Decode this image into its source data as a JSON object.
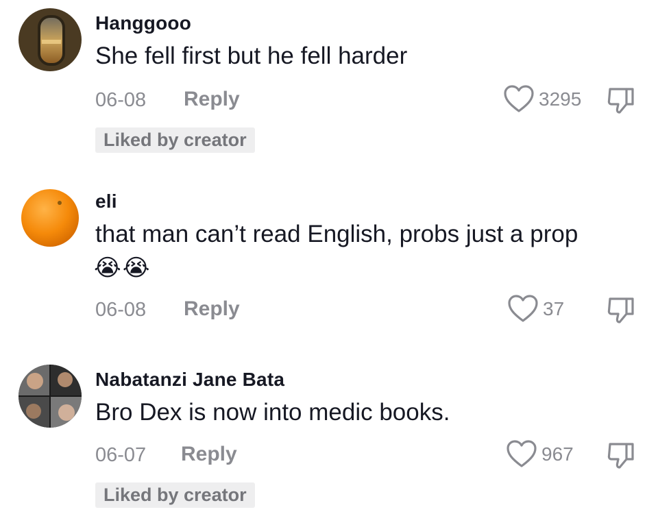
{
  "comments": [
    {
      "username": "Hanggooo",
      "text": "She fell first but he fell harder",
      "date": "06-08",
      "reply_label": "Reply",
      "likes": "3295",
      "badge": "Liked by creator",
      "avatar_icon": "airplane-window-sunset-avatar"
    },
    {
      "username": "eli",
      "text": "that man can’t read English, probs just a prop",
      "emojis": [
        "😭",
        "😭"
      ],
      "date": "06-08",
      "reply_label": "Reply",
      "likes": "37",
      "avatar_icon": "orange-fruit-avatar"
    },
    {
      "username": "Nabatanzi Jane Bata",
      "text": "Bro Dex is now into medic books.",
      "date": "06-07",
      "reply_label": "Reply",
      "likes": "967",
      "badge": "Liked by creator",
      "avatar_icon": "photo-collage-avatar"
    }
  ],
  "colors": {
    "text_primary": "#161823",
    "text_secondary": "#8a8b91",
    "badge_bg": "#eeeeef"
  }
}
